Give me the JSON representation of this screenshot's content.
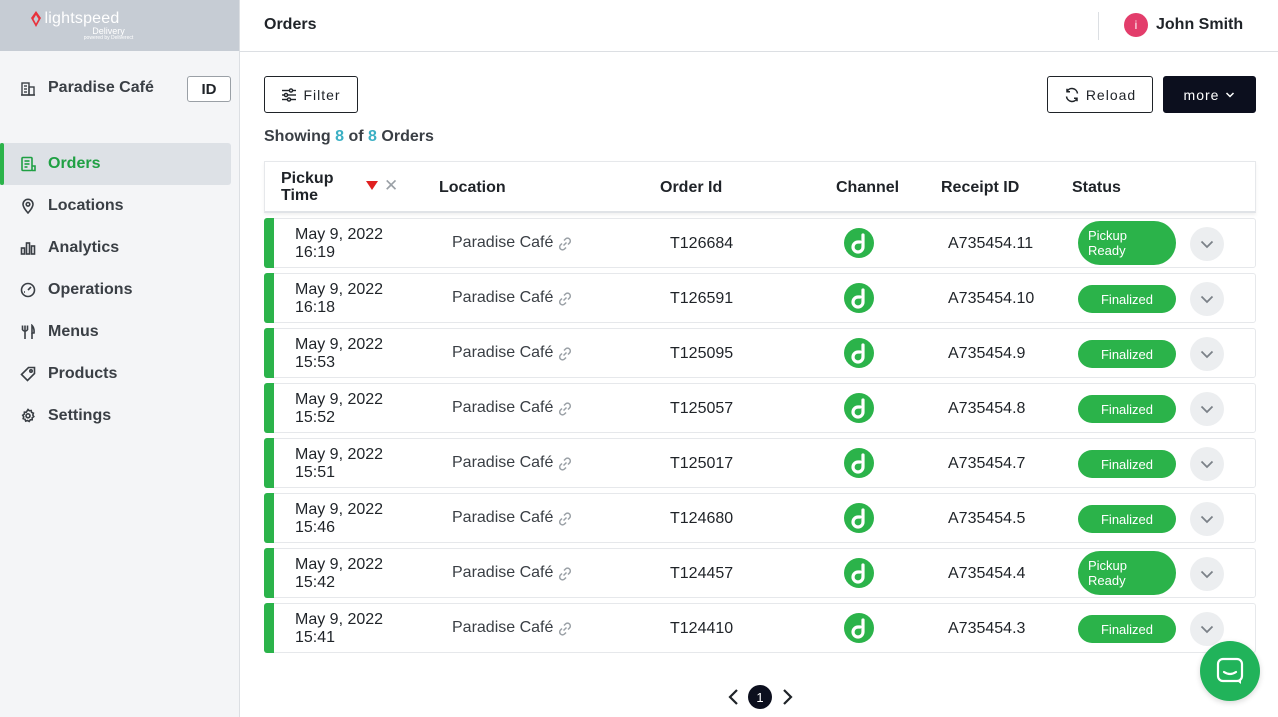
{
  "brand": {
    "name": "lightspeed",
    "sub": "Delivery",
    "powered": "powered by Deliverect"
  },
  "store": {
    "name": "Paradise Café",
    "id_badge": "ID"
  },
  "nav": [
    {
      "label": "Orders",
      "icon": "orders-icon",
      "active": true
    },
    {
      "label": "Locations",
      "icon": "location-pin-icon"
    },
    {
      "label": "Analytics",
      "icon": "bar-chart-icon"
    },
    {
      "label": "Operations",
      "icon": "gauge-icon"
    },
    {
      "label": "Menus",
      "icon": "fork-knife-icon"
    },
    {
      "label": "Products",
      "icon": "tag-icon"
    },
    {
      "label": "Settings",
      "icon": "gear-icon"
    }
  ],
  "header": {
    "title": "Orders",
    "user": {
      "initial": "i",
      "name": "John Smith"
    }
  },
  "toolbar": {
    "filter_label": "Filter",
    "reload_label": "Reload",
    "more_label": "more"
  },
  "showing": {
    "prefix": "Showing",
    "count": "8",
    "of": "of",
    "total": "8",
    "suffix": "Orders"
  },
  "table": {
    "columns": {
      "pickup_line1": "Pickup",
      "pickup_line2": "Time",
      "location": "Location",
      "order_id": "Order Id",
      "channel": "Channel",
      "receipt_id": "Receipt ID",
      "status": "Status"
    },
    "rows": [
      {
        "date": "May 9, 2022",
        "time": "16:19",
        "location": "Paradise Café",
        "order_id": "T126684",
        "receipt_id": "A735454.11",
        "status_line1": "Pickup",
        "status_line2": "Ready"
      },
      {
        "date": "May 9, 2022",
        "time": "16:18",
        "location": "Paradise Café",
        "order_id": "T126591",
        "receipt_id": "A735454.10",
        "status_line1": "Finalized",
        "status_line2": ""
      },
      {
        "date": "May 9, 2022",
        "time": "15:53",
        "location": "Paradise Café",
        "order_id": "T125095",
        "receipt_id": "A735454.9",
        "status_line1": "Finalized",
        "status_line2": ""
      },
      {
        "date": "May 9, 2022",
        "time": "15:52",
        "location": "Paradise Café",
        "order_id": "T125057",
        "receipt_id": "A735454.8",
        "status_line1": "Finalized",
        "status_line2": ""
      },
      {
        "date": "May 9, 2022",
        "time": "15:51",
        "location": "Paradise Café",
        "order_id": "T125017",
        "receipt_id": "A735454.7",
        "status_line1": "Finalized",
        "status_line2": ""
      },
      {
        "date": "May 9, 2022",
        "time": "15:46",
        "location": "Paradise Café",
        "order_id": "T124680",
        "receipt_id": "A735454.5",
        "status_line1": "Finalized",
        "status_line2": ""
      },
      {
        "date": "May 9, 2022",
        "time": "15:42",
        "location": "Paradise Café",
        "order_id": "T124457",
        "receipt_id": "A735454.4",
        "status_line1": "Pickup",
        "status_line2": "Ready"
      },
      {
        "date": "May 9, 2022",
        "time": "15:41",
        "location": "Paradise Café",
        "order_id": "T124410",
        "receipt_id": "A735454.3",
        "status_line1": "Finalized",
        "status_line2": ""
      }
    ]
  },
  "pagination": {
    "current": "1"
  },
  "colors": {
    "accent_green": "#2bb34a",
    "active_nav_text": "#1fa043",
    "count_blue": "#3bb0c4",
    "dark_button": "#0c0f1e",
    "sort_red": "#e02020",
    "avatar_pink": "#e33d6b",
    "brand_red": "#e8323c",
    "chat_green": "#21b35a"
  }
}
